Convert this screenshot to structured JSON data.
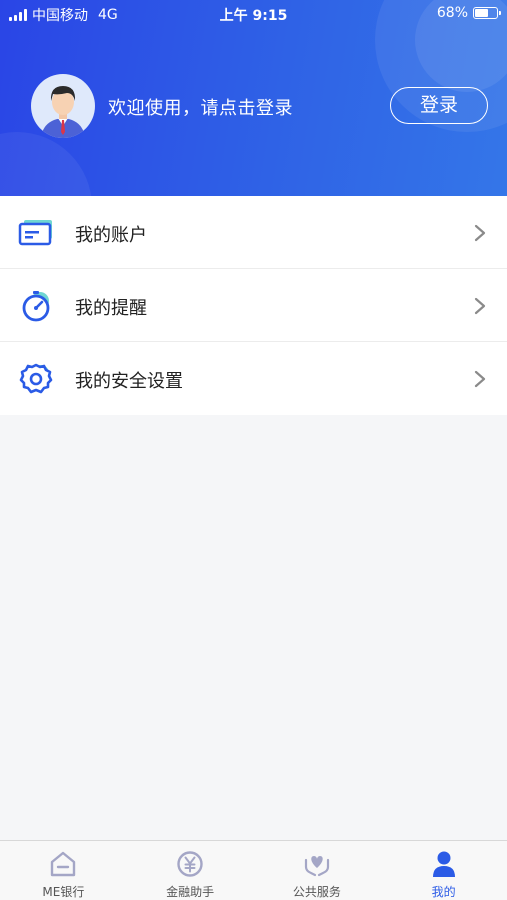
{
  "status_bar": {
    "carrier": "中国移动",
    "network": "4G",
    "time": "上午 9:15",
    "battery": "68%",
    "battery_level": 0.68
  },
  "header": {
    "welcome_text": "欢迎使用，请点击登录",
    "login_label": "登录",
    "avatar_icon": "user-avatar-icon"
  },
  "menu": {
    "items": [
      {
        "label": "我的账户",
        "icon": "account-card-icon"
      },
      {
        "label": "我的提醒",
        "icon": "reminder-clock-icon"
      },
      {
        "label": "我的安全设置",
        "icon": "security-gear-icon"
      }
    ]
  },
  "tabbar": {
    "items": [
      {
        "label": "ME银行",
        "icon": "home-icon",
        "active": false
      },
      {
        "label": "金融助手",
        "icon": "yuan-icon",
        "active": false
      },
      {
        "label": "公共服务",
        "icon": "heart-hands-icon",
        "active": false
      },
      {
        "label": "我的",
        "icon": "user-icon",
        "active": true
      }
    ]
  },
  "colors": {
    "header_gradient_start": "#2a45e6",
    "header_gradient_end": "#3476e8",
    "accent": "#2b5be6",
    "tab_inactive": "#a4a6c6",
    "background": "#f5f6f8"
  }
}
